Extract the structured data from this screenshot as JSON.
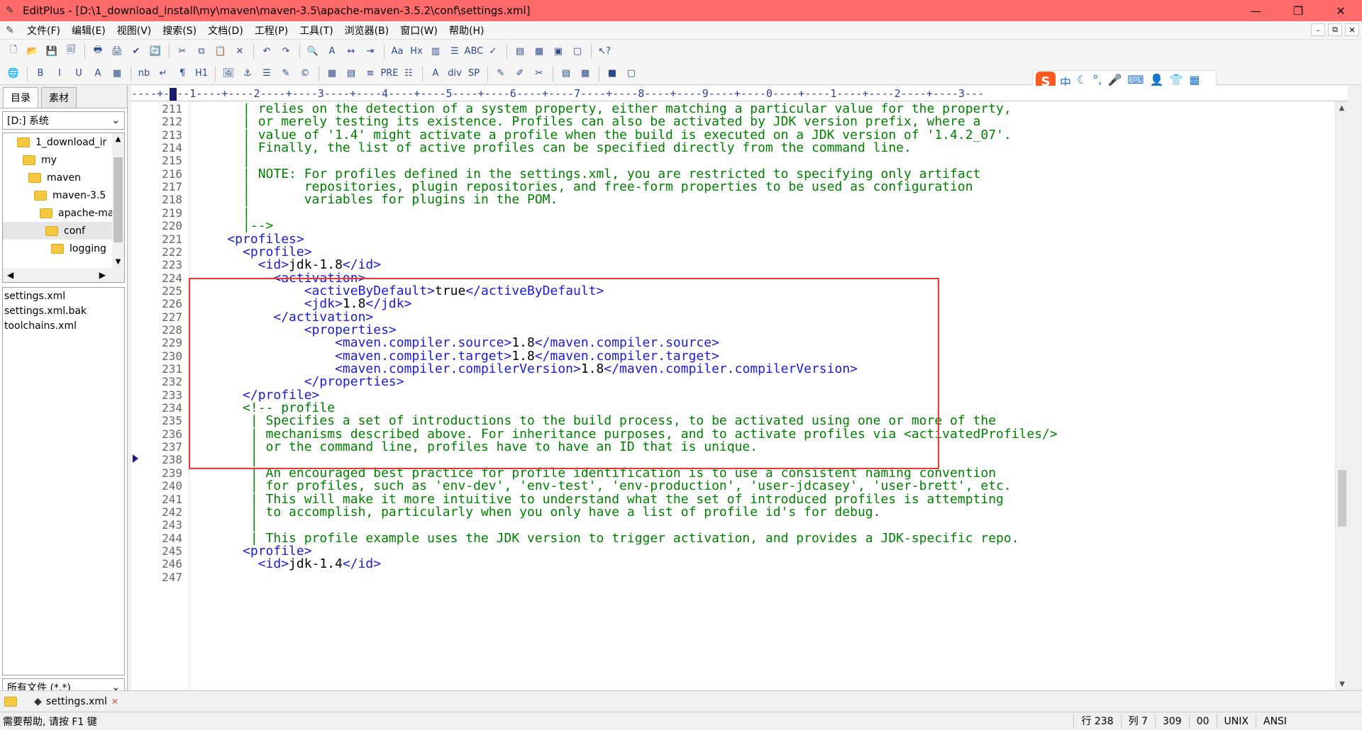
{
  "window": {
    "title": "EditPlus - [D:\\1_download_install\\my\\maven\\maven-3.5\\apache-maven-3.5.2\\conf\\settings.xml]",
    "min": "—",
    "max": "❐",
    "close": "✕"
  },
  "menu": {
    "items": [
      "文件(F)",
      "编辑(E)",
      "视图(V)",
      "搜索(S)",
      "文档(D)",
      "工程(P)",
      "工具(T)",
      "浏览器(B)",
      "窗口(W)",
      "帮助(H)"
    ],
    "mdi": [
      "–",
      "⧉",
      "✕"
    ]
  },
  "toolbar1": [
    "🗋",
    "📂",
    "💾",
    "🗐",
    "|",
    "🖶",
    "🖨",
    "✔",
    "🔄",
    "|",
    "✂",
    "⧉",
    "📋",
    "✕",
    "|",
    "↶",
    "↷",
    "|",
    "🔍",
    "A",
    "↔",
    "⇥",
    "|",
    "Aа",
    "Hx",
    "▥",
    "☰",
    "ABC",
    "✓",
    "|",
    "▤",
    "▦",
    "▣",
    "▢",
    "|",
    "↖?"
  ],
  "toolbar2": [
    "🌐",
    "|",
    "B",
    "I",
    "U",
    "A",
    "▦",
    "|",
    "nb",
    "↵",
    "¶",
    "H1",
    "|",
    "🖼",
    "⚓",
    "☰",
    "✎",
    "©",
    "|",
    "▦",
    "▤",
    "≡",
    "PRE",
    "☷",
    "|",
    "A",
    "div",
    "SP",
    "|",
    "✎",
    "✐",
    "✂",
    "|",
    "▤",
    "▦",
    "|",
    "■",
    "▢"
  ],
  "ime": {
    "logo": "S",
    "items": [
      "中",
      "☾",
      "°,",
      "🎤",
      "⌨",
      "👤",
      "👕",
      "▦"
    ]
  },
  "left_panel": {
    "tabs": [
      "目录",
      "素材"
    ],
    "drive": "[D:] 系统",
    "tree": [
      {
        "label": "1_download_ir",
        "indent": 0
      },
      {
        "label": "my",
        "indent": 1
      },
      {
        "label": "maven",
        "indent": 2
      },
      {
        "label": "maven-3.5",
        "indent": 3
      },
      {
        "label": "apache-ma",
        "indent": 4
      },
      {
        "label": "conf",
        "indent": 5,
        "selected": true
      },
      {
        "label": "logging",
        "indent": 6
      }
    ],
    "files": [
      "settings.xml",
      "settings.xml.bak",
      "toolchains.xml"
    ],
    "filter": "所有文件 (*.*)"
  },
  "ruler_text": "----+-",
  "ruler_rest": "--1----+----2----+----3----+----4----+----5----+----6----+----7----+----8----+----9----+----0----+----1----+----2----+----3---",
  "editor": {
    "lines": [
      {
        "n": "211",
        "parts": [
          [
            "c",
            "      | relies on the detection of a system property, either matching a particular value for the property,"
          ]
        ]
      },
      {
        "n": "212",
        "parts": [
          [
            "c",
            "      | or merely testing its existence. Profiles can also be activated by JDK version prefix, where a"
          ]
        ]
      },
      {
        "n": "213",
        "parts": [
          [
            "c",
            "      | value of '1.4' might activate a profile when the build is executed on a JDK version of '1.4.2_07'."
          ]
        ]
      },
      {
        "n": "214",
        "parts": [
          [
            "c",
            "      | Finally, the list of active profiles can be specified directly from the command line."
          ]
        ]
      },
      {
        "n": "215",
        "parts": [
          [
            "c",
            "      |"
          ]
        ]
      },
      {
        "n": "216",
        "parts": [
          [
            "c",
            "      | NOTE: For profiles defined in the settings.xml, you are restricted to specifying only artifact"
          ]
        ]
      },
      {
        "n": "217",
        "parts": [
          [
            "c",
            "      |       repositories, plugin repositories, and free-form properties to be used as configuration"
          ]
        ]
      },
      {
        "n": "218",
        "parts": [
          [
            "c",
            "      |       variables for plugins in the POM."
          ]
        ]
      },
      {
        "n": "219",
        "parts": [
          [
            "c",
            "      |"
          ]
        ]
      },
      {
        "n": "220",
        "parts": [
          [
            "c",
            "      |-->"
          ]
        ]
      },
      {
        "n": "221",
        "parts": [
          [
            "t",
            "    <profiles>"
          ]
        ]
      },
      {
        "n": "222",
        "parts": [
          [
            "t",
            "      <profile>"
          ]
        ]
      },
      {
        "n": "223",
        "parts": [
          [
            "t",
            "        <id>"
          ],
          [
            "x",
            "jdk-1.8"
          ],
          [
            "t",
            "</id>"
          ]
        ]
      },
      {
        "n": "224",
        "parts": [
          [
            "t",
            "          <activation>"
          ]
        ]
      },
      {
        "n": "225",
        "parts": [
          [
            "t",
            "              <activeByDefault>"
          ],
          [
            "x",
            "true"
          ],
          [
            "t",
            "</activeByDefault>"
          ]
        ]
      },
      {
        "n": "226",
        "parts": [
          [
            "t",
            "              <jdk>"
          ],
          [
            "x",
            "1.8"
          ],
          [
            "t",
            "</jdk>"
          ]
        ]
      },
      {
        "n": "227",
        "parts": [
          [
            "t",
            "          </activation>"
          ]
        ]
      },
      {
        "n": "228",
        "parts": [
          [
            "t",
            "              <properties>"
          ]
        ]
      },
      {
        "n": "229",
        "parts": [
          [
            "t",
            "                  <maven.compiler.source>"
          ],
          [
            "x",
            "1.8"
          ],
          [
            "t",
            "</maven.compiler.source>"
          ]
        ]
      },
      {
        "n": "230",
        "parts": [
          [
            "t",
            "                  <maven.compiler.target>"
          ],
          [
            "x",
            "1.8"
          ],
          [
            "t",
            "</maven.compiler.target>"
          ]
        ]
      },
      {
        "n": "231",
        "parts": [
          [
            "t",
            "                  <maven.compiler.compilerVersion>"
          ],
          [
            "x",
            "1.8"
          ],
          [
            "t",
            "</maven.compiler.compilerVersion>"
          ]
        ]
      },
      {
        "n": "232",
        "parts": [
          [
            "t",
            "              </properties>"
          ]
        ]
      },
      {
        "n": "233",
        "parts": [
          [
            "t",
            "      </profile>"
          ]
        ]
      },
      {
        "n": "234",
        "parts": [
          [
            "c",
            "      <!-- profile"
          ]
        ]
      },
      {
        "n": "235",
        "parts": [
          [
            "c",
            "       | Specifies a set of introductions to the build process, to be activated using one or more of the"
          ]
        ]
      },
      {
        "n": "236",
        "parts": [
          [
            "c",
            "       | mechanisms described above. For inheritance purposes, and to activate profiles via <activatedProfiles/>"
          ]
        ]
      },
      {
        "n": "237",
        "parts": [
          [
            "c",
            "       | or the command line, profiles have to have an ID that is unique."
          ]
        ]
      },
      {
        "n": "238",
        "parts": [
          [
            "c",
            "       |"
          ]
        ],
        "bookmark": true
      },
      {
        "n": "239",
        "parts": [
          [
            "c",
            "       | An encouraged best practice for profile identification is to use a consistent naming convention"
          ]
        ]
      },
      {
        "n": "240",
        "parts": [
          [
            "c",
            "       | for profiles, such as 'env-dev', 'env-test', 'env-production', 'user-jdcasey', 'user-brett', etc."
          ]
        ]
      },
      {
        "n": "241",
        "parts": [
          [
            "c",
            "       | This will make it more intuitive to understand what the set of introduced profiles is attempting"
          ]
        ]
      },
      {
        "n": "242",
        "parts": [
          [
            "c",
            "       | to accomplish, particularly when you only have a list of profile id's for debug."
          ]
        ]
      },
      {
        "n": "243",
        "parts": [
          [
            "c",
            "       |"
          ]
        ]
      },
      {
        "n": "244",
        "parts": [
          [
            "c",
            "       | This profile example uses the JDK version to trigger activation, and provides a JDK-specific repo."
          ]
        ]
      },
      {
        "n": "245",
        "parts": [
          [
            "t",
            "      <profile>"
          ]
        ]
      },
      {
        "n": "246",
        "parts": [
          [
            "t",
            "        <id>"
          ],
          [
            "x",
            "jdk-1.4"
          ],
          [
            "t",
            "</id>"
          ]
        ]
      },
      {
        "n": "247",
        "parts": []
      }
    ]
  },
  "doctab": {
    "label": "settings.xml",
    "close": "✕"
  },
  "status": {
    "help": "需要帮助, 请按 F1 键",
    "line": "行 238",
    "col": "列 7",
    "chars": "309",
    "code": "00",
    "eol": "UNIX",
    "encoding": "ANSI"
  },
  "colors": {
    "titlebar": "#ff6b6b",
    "comment": "#008000",
    "tag": "#1b1bd6",
    "highlight": "#e53935"
  }
}
